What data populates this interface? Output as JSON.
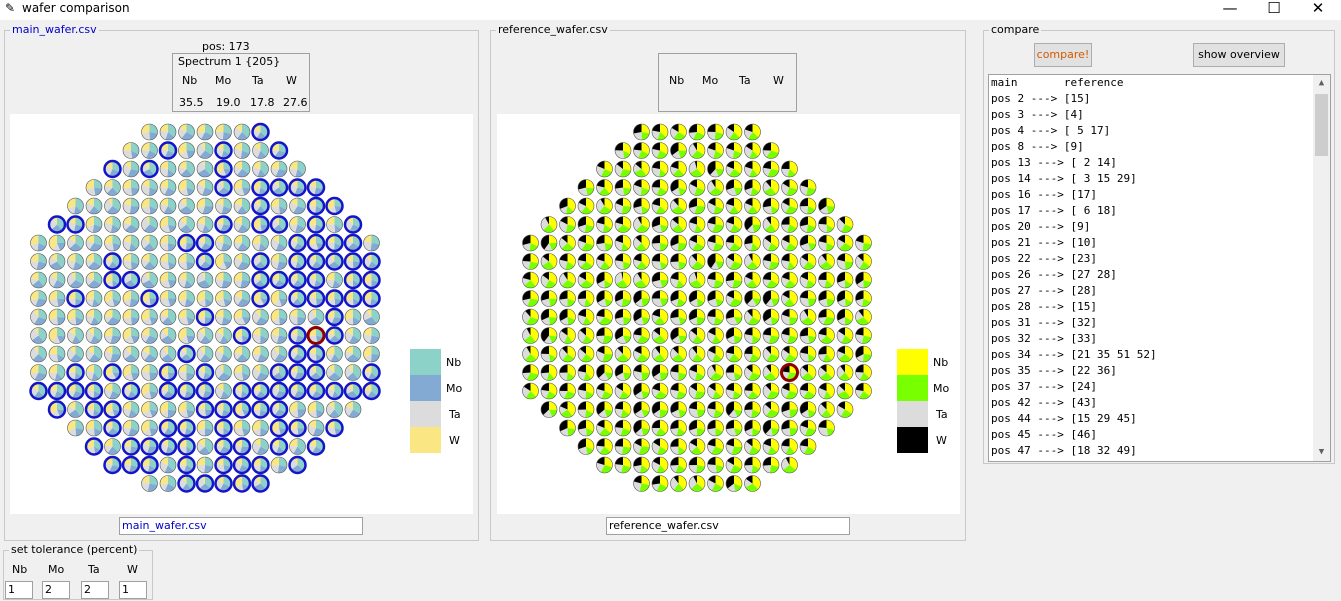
{
  "window": {
    "title": "wafer comparison",
    "minimize": "—",
    "maximize": "☐",
    "close": "✕"
  },
  "main": {
    "group_label": "main_wafer.csv",
    "pos_label": "pos: 173",
    "spectrum_label": "Spectrum 1 {205}",
    "elements": [
      "Nb",
      "Mo",
      "Ta",
      "W"
    ],
    "values": [
      "35.5",
      "19.0",
      "17.8",
      "27.6"
    ],
    "file_entry": "main_wafer.csv",
    "legend": [
      {
        "label": "Nb",
        "color": "#8cd2c8"
      },
      {
        "label": "Mo",
        "color": "#82aad2"
      },
      {
        "label": "Ta",
        "color": "#dcdcdc"
      },
      {
        "label": "W",
        "color": "#fae682"
      }
    ]
  },
  "reference": {
    "group_label": "reference_wafer.csv",
    "elements": [
      "Nb",
      "Mo",
      "Ta",
      "W"
    ],
    "file_entry": "reference_wafer.csv",
    "legend": [
      {
        "label": "Nb",
        "color": "#ffff00"
      },
      {
        "label": "Mo",
        "color": "#78ff00"
      },
      {
        "label": "Ta",
        "color": "#dcdcdc"
      },
      {
        "label": "W",
        "color": "#000000"
      }
    ]
  },
  "compare": {
    "group_label": "compare",
    "compare_button": "compare!",
    "overview_button": "show overview",
    "header": "main       reference",
    "rows": [
      "pos 2 ---> [15]",
      "pos 3 ---> [4]",
      "pos 4 ---> [ 5 17]",
      "pos 8 ---> [9]",
      "pos 13 ---> [ 2 14]",
      "pos 14 ---> [ 3 15 29]",
      "pos 16 ---> [17]",
      "pos 17 ---> [ 6 18]",
      "pos 20 ---> [9]",
      "pos 21 ---> [10]",
      "pos 22 ---> [23]",
      "pos 26 ---> [27 28]",
      "pos 27 ---> [28]",
      "pos 28 ---> [15]",
      "pos 31 ---> [32]",
      "pos 32 ---> [33]",
      "pos 34 ---> [21 35 51 52]",
      "pos 35 ---> [22 36]",
      "pos 37 ---> [24]",
      "pos 42 ---> [43]",
      "pos 44 ---> [15 29 45]",
      "pos 45 ---> [46]",
      "pos 47 ---> [18 32 49]"
    ]
  },
  "tolerance": {
    "group_label": "set tolerance (percent)",
    "fields": [
      {
        "label": "Nb",
        "value": "1"
      },
      {
        "label": "Mo",
        "value": "2"
      },
      {
        "label": "Ta",
        "value": "2"
      },
      {
        "label": "W",
        "value": "1"
      }
    ]
  }
}
